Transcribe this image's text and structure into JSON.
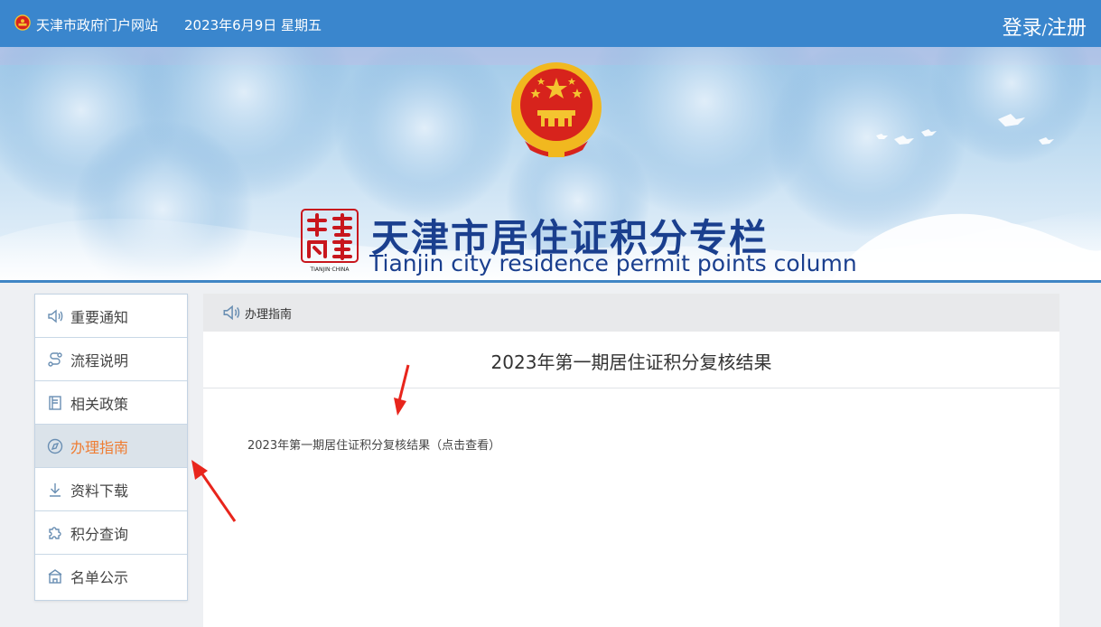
{
  "topbar": {
    "site_name": "天津市政府门户网站",
    "date": "2023年6月9日 星期五",
    "login": "登录",
    "slash": "/",
    "register": "注册"
  },
  "banner": {
    "title": "天津市居住证积分专栏",
    "subtitle": "Tianjin city residence permit points column",
    "seal_text": "TIANJIN·CHINA"
  },
  "sidebar": {
    "items": [
      {
        "label": "重要通知",
        "icon": "speaker-icon",
        "active": false
      },
      {
        "label": "流程说明",
        "icon": "flow-icon",
        "active": false
      },
      {
        "label": "相关政策",
        "icon": "book-icon",
        "active": false
      },
      {
        "label": "办理指南",
        "icon": "compass-icon",
        "active": true
      },
      {
        "label": "资料下载",
        "icon": "download-icon",
        "active": false
      },
      {
        "label": "积分查询",
        "icon": "puzzle-icon",
        "active": false
      },
      {
        "label": "名单公示",
        "icon": "building-icon",
        "active": false
      }
    ]
  },
  "main": {
    "breadcrumb": "办理指南",
    "title": "2023年第一期居住证积分复核结果",
    "link_text": "2023年第一期居住证积分复核结果（点击查看）"
  },
  "colors": {
    "topbar": "#3a86cd",
    "active_text": "#ef7d33",
    "title_blue": "#1a3f8e",
    "annotation_red": "#e8251c"
  }
}
